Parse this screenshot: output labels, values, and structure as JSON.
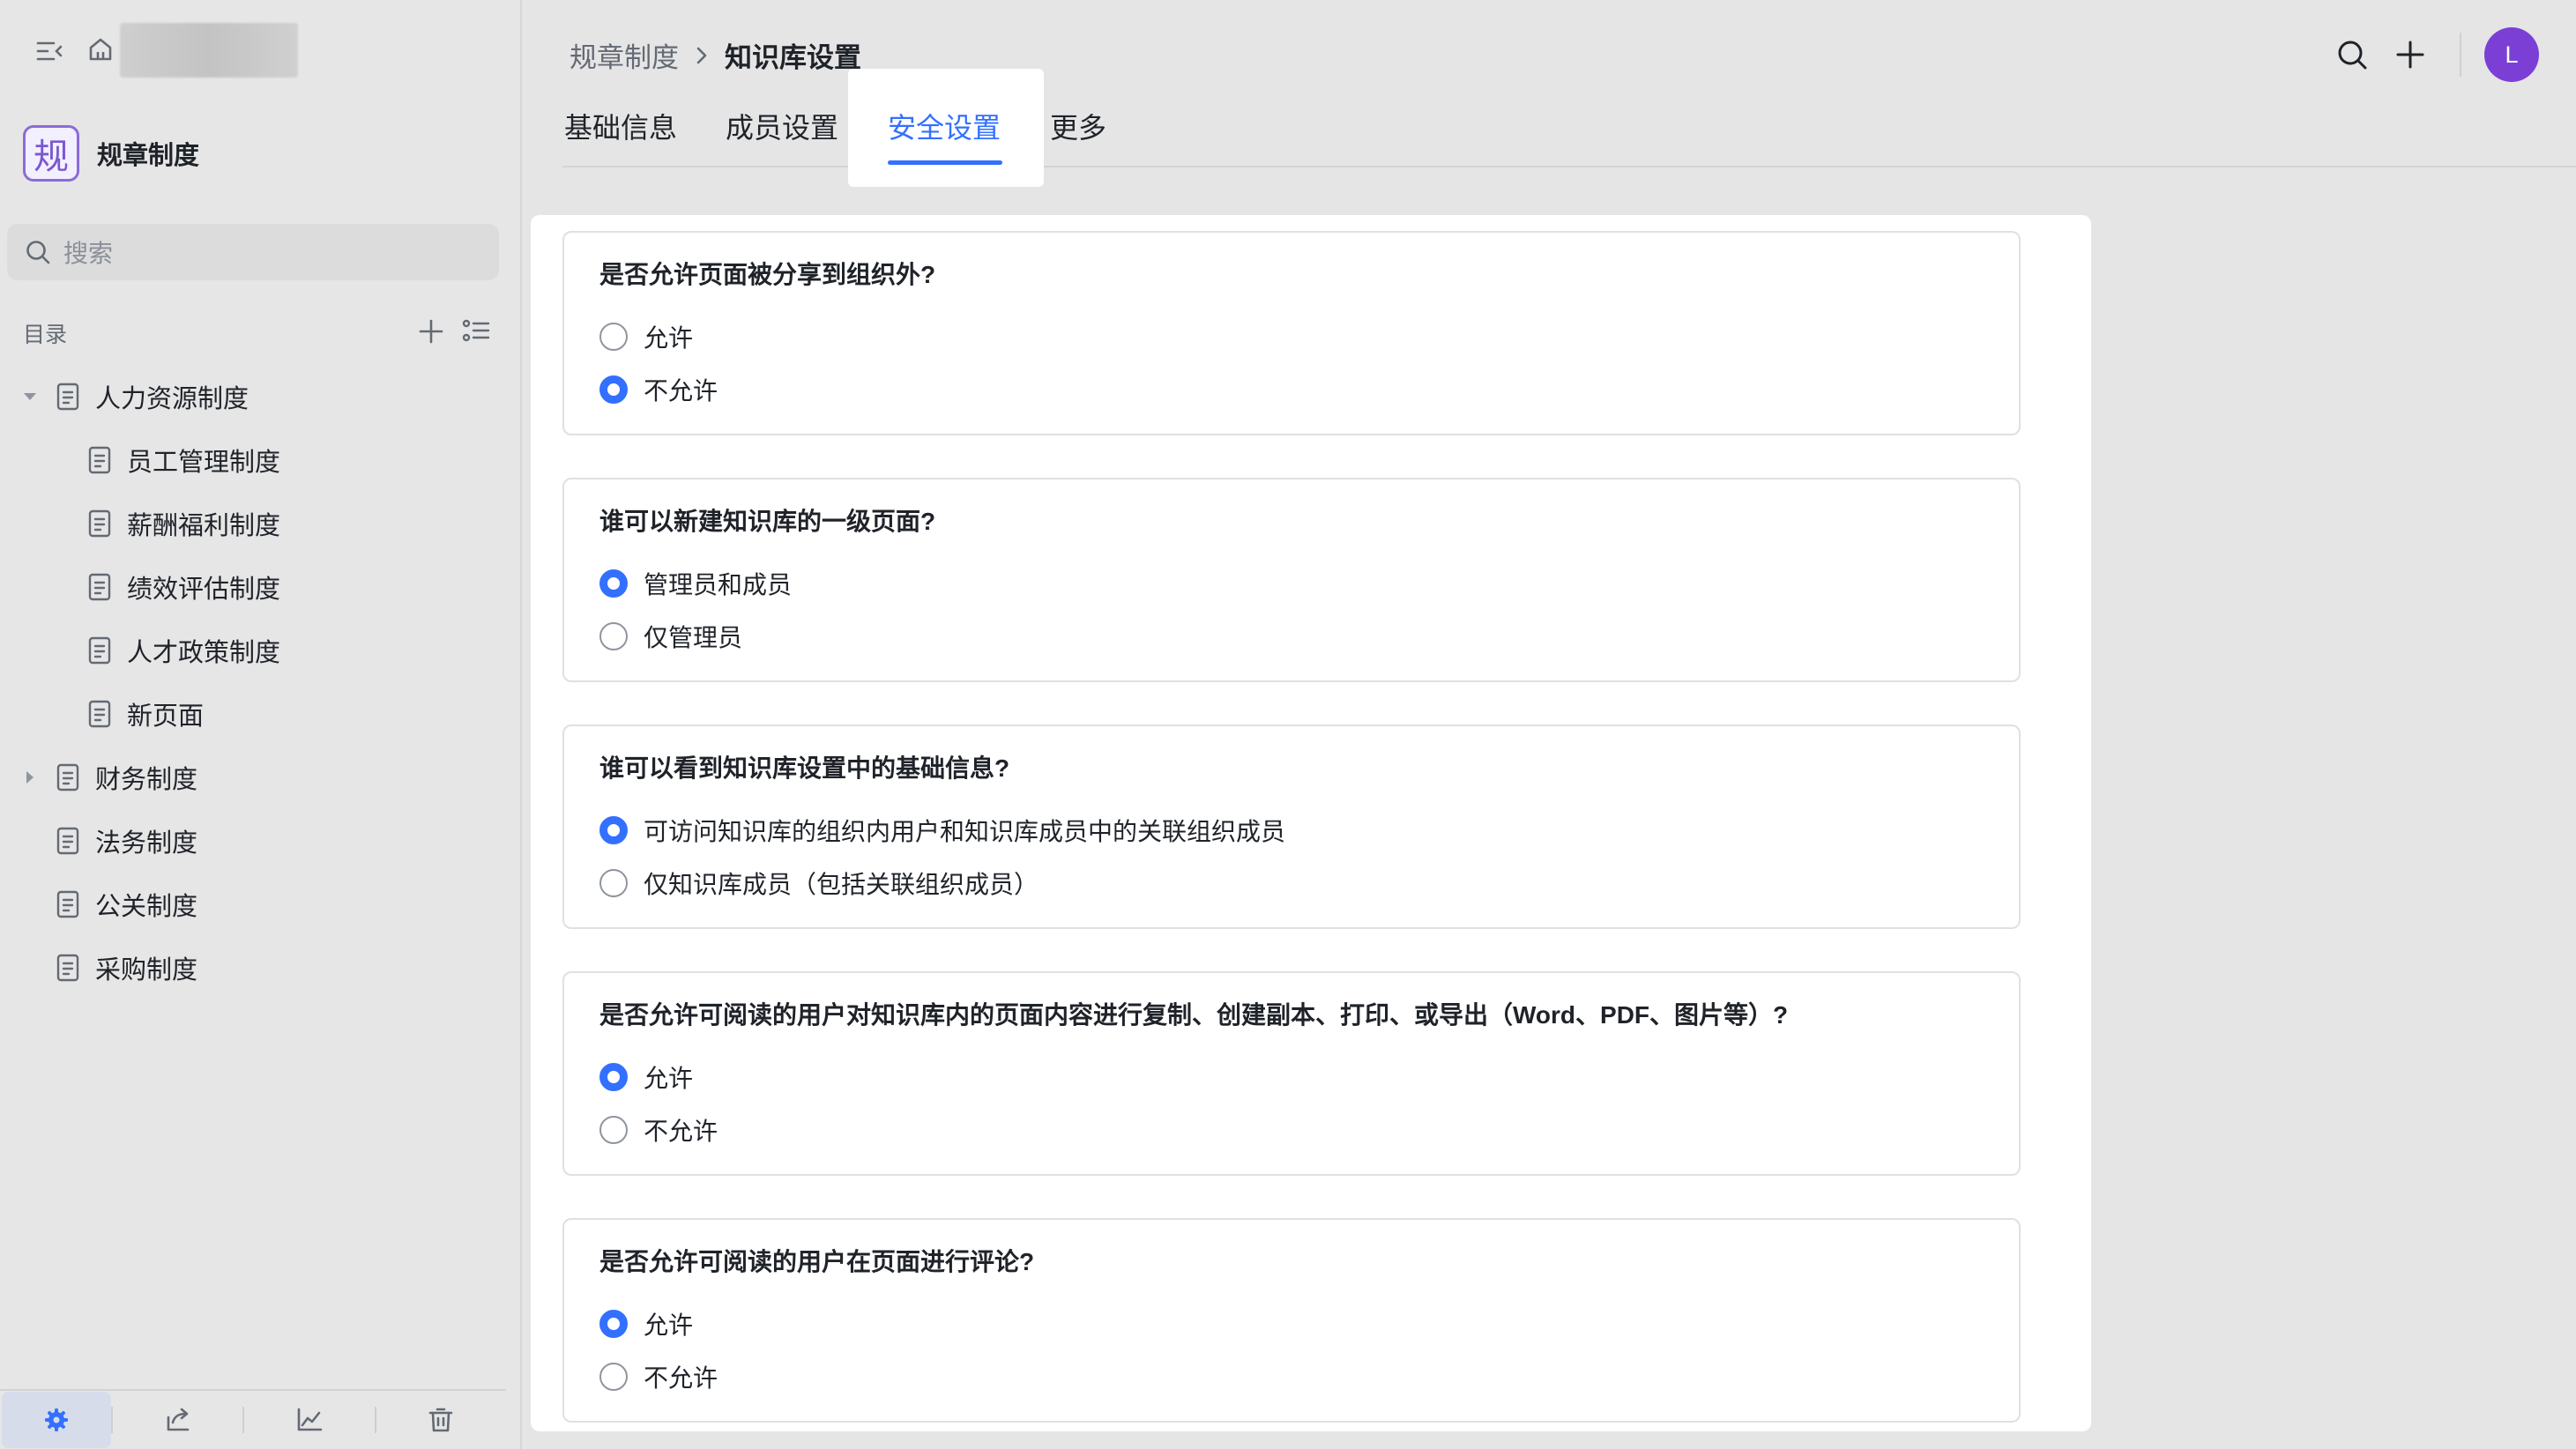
{
  "sidebar": {
    "space_logo": "规",
    "space_name": "规章制度",
    "search_placeholder": "搜索",
    "toc_label": "目录",
    "tree": [
      {
        "label": "人力资源制度",
        "level": 0,
        "caret": "down"
      },
      {
        "label": "员工管理制度",
        "level": 1,
        "caret": ""
      },
      {
        "label": "薪酬福利制度",
        "level": 1,
        "caret": ""
      },
      {
        "label": "绩效评估制度",
        "level": 1,
        "caret": ""
      },
      {
        "label": "人才政策制度",
        "level": 1,
        "caret": ""
      },
      {
        "label": "新页面",
        "level": 1,
        "caret": ""
      },
      {
        "label": "财务制度",
        "level": 0,
        "caret": "right"
      },
      {
        "label": "法务制度",
        "level": 0,
        "caret": ""
      },
      {
        "label": "公关制度",
        "level": 0,
        "caret": ""
      },
      {
        "label": "采购制度",
        "level": 0,
        "caret": ""
      }
    ]
  },
  "header": {
    "breadcrumb_parent": "规章制度",
    "breadcrumb_current": "知识库设置",
    "avatar_letter": "L"
  },
  "tabs": [
    "基础信息",
    "成员设置",
    "安全设置",
    "更多"
  ],
  "active_tab": "安全设置",
  "questions": [
    {
      "title": "是否允许页面被分享到组织外?",
      "options": [
        "允许",
        "不允许"
      ],
      "selected": 1
    },
    {
      "title": "谁可以新建知识库的一级页面?",
      "options": [
        "管理员和成员",
        "仅管理员"
      ],
      "selected": 0
    },
    {
      "title": "谁可以看到知识库设置中的基础信息?",
      "options": [
        "可访问知识库的组织内用户和知识库成员中的关联组织成员",
        "仅知识库成员（包括关联组织成员）"
      ],
      "selected": 0
    },
    {
      "title": "是否允许可阅读的用户对知识库内的页面内容进行复制、创建副本、打印、或导出（Word、PDF、图片等）?",
      "options": [
        "允许",
        "不允许"
      ],
      "selected": 0
    },
    {
      "title": "是否允许可阅读的用户在页面进行评论?",
      "options": [
        "允许",
        "不允许"
      ],
      "selected": 0
    }
  ],
  "colors": {
    "accent": "#3370ff",
    "avatar": "#7c3fd6",
    "logo": "#7b57d1"
  }
}
